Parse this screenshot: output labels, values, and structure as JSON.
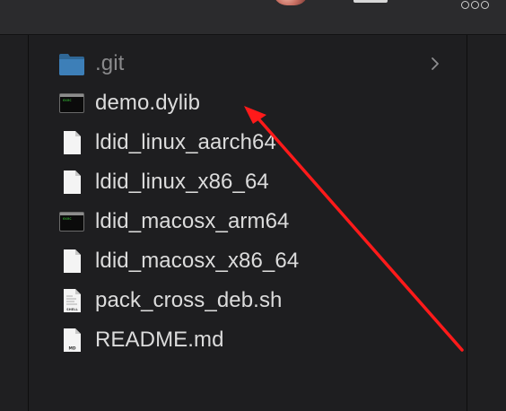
{
  "file_list": [
    {
      "name": ".git",
      "icon": "folder-icon",
      "kind": "folder",
      "has_chevron": true
    },
    {
      "name": "demo.dylib",
      "icon": "exec-icon",
      "kind": "exec"
    },
    {
      "name": "ldid_linux_aarch64",
      "icon": "document-icon",
      "kind": "doc"
    },
    {
      "name": "ldid_linux_x86_64",
      "icon": "document-icon",
      "kind": "doc"
    },
    {
      "name": "ldid_macosx_arm64",
      "icon": "exec-icon",
      "kind": "exec"
    },
    {
      "name": "ldid_macosx_x86_64",
      "icon": "document-icon",
      "kind": "doc"
    },
    {
      "name": "pack_cross_deb.sh",
      "icon": "shell-script-icon",
      "kind": "shell",
      "badge": "SHELL"
    },
    {
      "name": "README.md",
      "icon": "markdown-file-icon",
      "kind": "md",
      "badge": "MD"
    }
  ],
  "exec_icon_text": "exec",
  "colors": {
    "background": "#1e1e20",
    "text": "#dcdcdc",
    "dim_text": "#8a8a8c",
    "folder": "#3d7fb8",
    "annotation_arrow": "#ff1a1a"
  }
}
